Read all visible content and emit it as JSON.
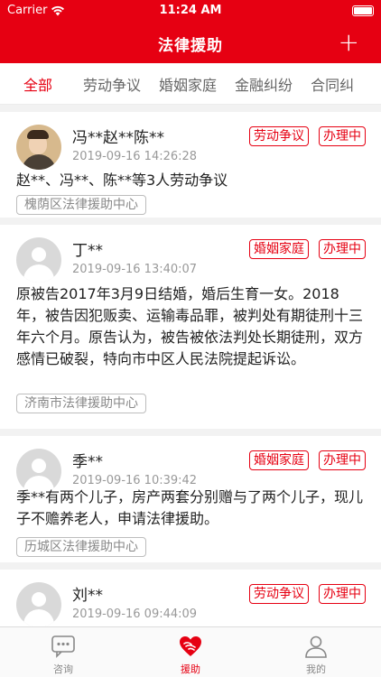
{
  "status_bar": {
    "carrier": "Carrier",
    "time": "11:24 AM"
  },
  "nav": {
    "title": "法律援助",
    "add_icon": "plus-icon"
  },
  "tabs": [
    "全部",
    "劳动争议",
    "婚姻家庭",
    "金融纠纷",
    "合同纠"
  ],
  "active_tab": "全部",
  "cases": [
    {
      "name": "冯**赵**陈**",
      "date": "2019-09-16 14:26:28",
      "category": "劳动争议",
      "status": "办理中",
      "description": "赵**、冯**、陈**等3人劳动争议",
      "center": "槐荫区法律援助中心",
      "avatar": "photo"
    },
    {
      "name": "丁**",
      "date": "2019-09-16 13:40:07",
      "category": "婚姻家庭",
      "status": "办理中",
      "description": "原被告2017年3月9日结婚，婚后生育一女。2018年，被告因犯贩卖、运输毒品罪，被判处有期徒刑十三年六个月。原告认为，被告被依法判处长期徒刑，双方感情已破裂，特向市中区人民法院提起诉讼。",
      "center": "济南市法律援助中心",
      "avatar": "default"
    },
    {
      "name": "季**",
      "date": "2019-09-16 10:39:42",
      "category": "婚姻家庭",
      "status": "办理中",
      "description": "季**有两个儿子，房产两套分别赠与了两个儿子，现儿子不赡养老人，申请法律援助。",
      "center": "历城区法律援助中心",
      "avatar": "default"
    },
    {
      "name": "刘**",
      "date": "2019-09-16 09:44:09",
      "category": "劳动争议",
      "status": "办理中",
      "description": "",
      "center": "",
      "avatar": "default"
    }
  ],
  "tabbar": [
    {
      "label": "咨询",
      "icon": "chat-bubble-icon"
    },
    {
      "label": "援助",
      "icon": "heart-hands-icon"
    },
    {
      "label": "我的",
      "icon": "person-icon"
    }
  ],
  "active_tabbar": "援助",
  "colors": {
    "brand_red": "#e60012",
    "background": "#f2f2f2"
  }
}
